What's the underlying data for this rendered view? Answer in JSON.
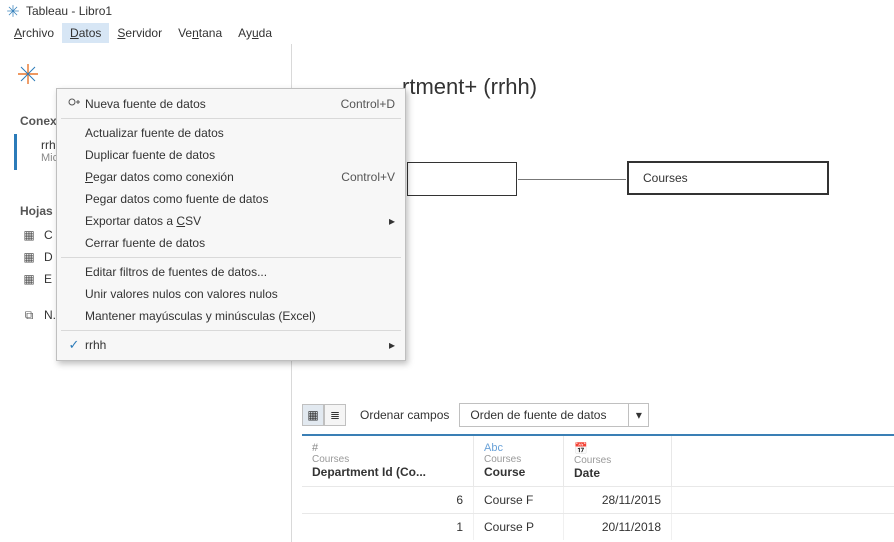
{
  "titlebar": {
    "title": "Tableau - Libro1"
  },
  "menubar": {
    "items": [
      {
        "label": "Archivo"
      },
      {
        "label": "Datos"
      },
      {
        "label": "Servidor"
      },
      {
        "label": "Ventana"
      },
      {
        "label": "Ayuda"
      }
    ],
    "active_index": 1
  },
  "dropdown": {
    "groups": [
      [
        {
          "label": "Nueva fuente de datos",
          "shortcut": "Control+D",
          "icon": "new-datasource-icon"
        }
      ],
      [
        {
          "label": "Actualizar fuente de datos"
        },
        {
          "label": "Duplicar fuente de datos"
        },
        {
          "label": "Pegar datos como conexión",
          "shortcut": "Control+V",
          "underlined": true
        },
        {
          "label": "Pegar datos como fuente de datos"
        },
        {
          "label": "Exportar datos a CSV",
          "submenu": true,
          "underlined_part": "CSV"
        },
        {
          "label": "Cerrar fuente de datos"
        }
      ],
      [
        {
          "label": "Editar filtros de fuentes de datos..."
        },
        {
          "label": "Unir valores nulos con valores nulos"
        },
        {
          "label": "Mantener mayúsculas y minúsculas (Excel)"
        }
      ],
      [
        {
          "label": "rrhh",
          "submenu": true,
          "checked": true
        }
      ]
    ]
  },
  "left": {
    "connections_label": "Conex",
    "connection": {
      "name": "rrhh",
      "subtitle": "Mic"
    },
    "sheets_label": "Hojas",
    "sheets": [
      {
        "icon": "sheet-grid-icon",
        "label": "C"
      },
      {
        "icon": "sheet-grid-icon",
        "label": "D"
      },
      {
        "icon": "sheet-grid-icon",
        "label": "E"
      }
    ],
    "new_union_icon": "new-union-icon"
  },
  "canvas": {
    "title": "rtment+ (rrhh)",
    "table_chip_left": "",
    "table_chip_right": "Courses"
  },
  "grid": {
    "order_label": "Ordenar campos",
    "order_value": "Orden de fuente de datos",
    "columns": [
      {
        "type_icon": "#",
        "source": "Courses",
        "name": "Department Id (Co..."
      },
      {
        "type_icon": "Abc",
        "source": "Courses",
        "name": "Course"
      },
      {
        "type_icon": "date",
        "source": "Courses",
        "name": "Date"
      }
    ],
    "rows": [
      {
        "c1": "6",
        "c2": "Course F",
        "c3": "28/11/2015"
      },
      {
        "c1": "1",
        "c2": "Course P",
        "c3": "20/11/2018"
      }
    ]
  }
}
